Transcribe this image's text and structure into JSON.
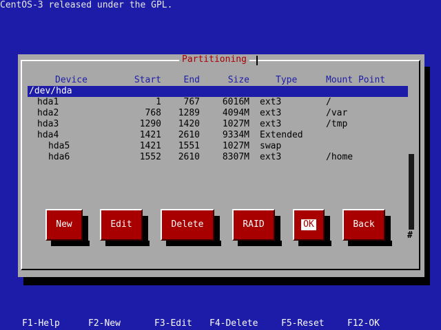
{
  "banner": "CentOS-3 released under the GPL.",
  "dialog": {
    "title": "Partitioning"
  },
  "columns": {
    "device": "Device",
    "start": "Start",
    "end": "End",
    "size": "Size",
    "type": "Type",
    "mount": "Mount Point"
  },
  "disk": "/dev/hda",
  "partitions": [
    {
      "device": "hda1",
      "start": "1",
      "end": "767",
      "size": "6016M",
      "type": "ext3",
      "mount": "/"
    },
    {
      "device": "hda2",
      "start": "768",
      "end": "1289",
      "size": "4094M",
      "type": "ext3",
      "mount": "/var"
    },
    {
      "device": "hda3",
      "start": "1290",
      "end": "1420",
      "size": "1027M",
      "type": "ext3",
      "mount": "/tmp"
    },
    {
      "device": "hda4",
      "start": "1421",
      "end": "2610",
      "size": "9334M",
      "type": "Extended",
      "mount": ""
    },
    {
      "device": "hda5",
      "start": "1421",
      "end": "1551",
      "size": "1027M",
      "type": "swap",
      "mount": ""
    },
    {
      "device": "hda6",
      "start": "1552",
      "end": "2610",
      "size": "8307M",
      "type": "ext3",
      "mount": "/home"
    }
  ],
  "scroll_mark": "#",
  "buttons": {
    "new": "New",
    "edit": "Edit",
    "delete": "Delete",
    "raid": "RAID",
    "ok": "OK",
    "back": "Back"
  },
  "footer": {
    "f1": "F1-Help",
    "f2": "F2-New",
    "f3": "F3-Edit",
    "f4": "F4-Delete",
    "f5": "F5-Reset",
    "f12": "F12-OK"
  },
  "colors": {
    "background": "#1c1ca8",
    "dialog": "#a8a8a8",
    "button": "#a80000",
    "title": "#a80000"
  }
}
